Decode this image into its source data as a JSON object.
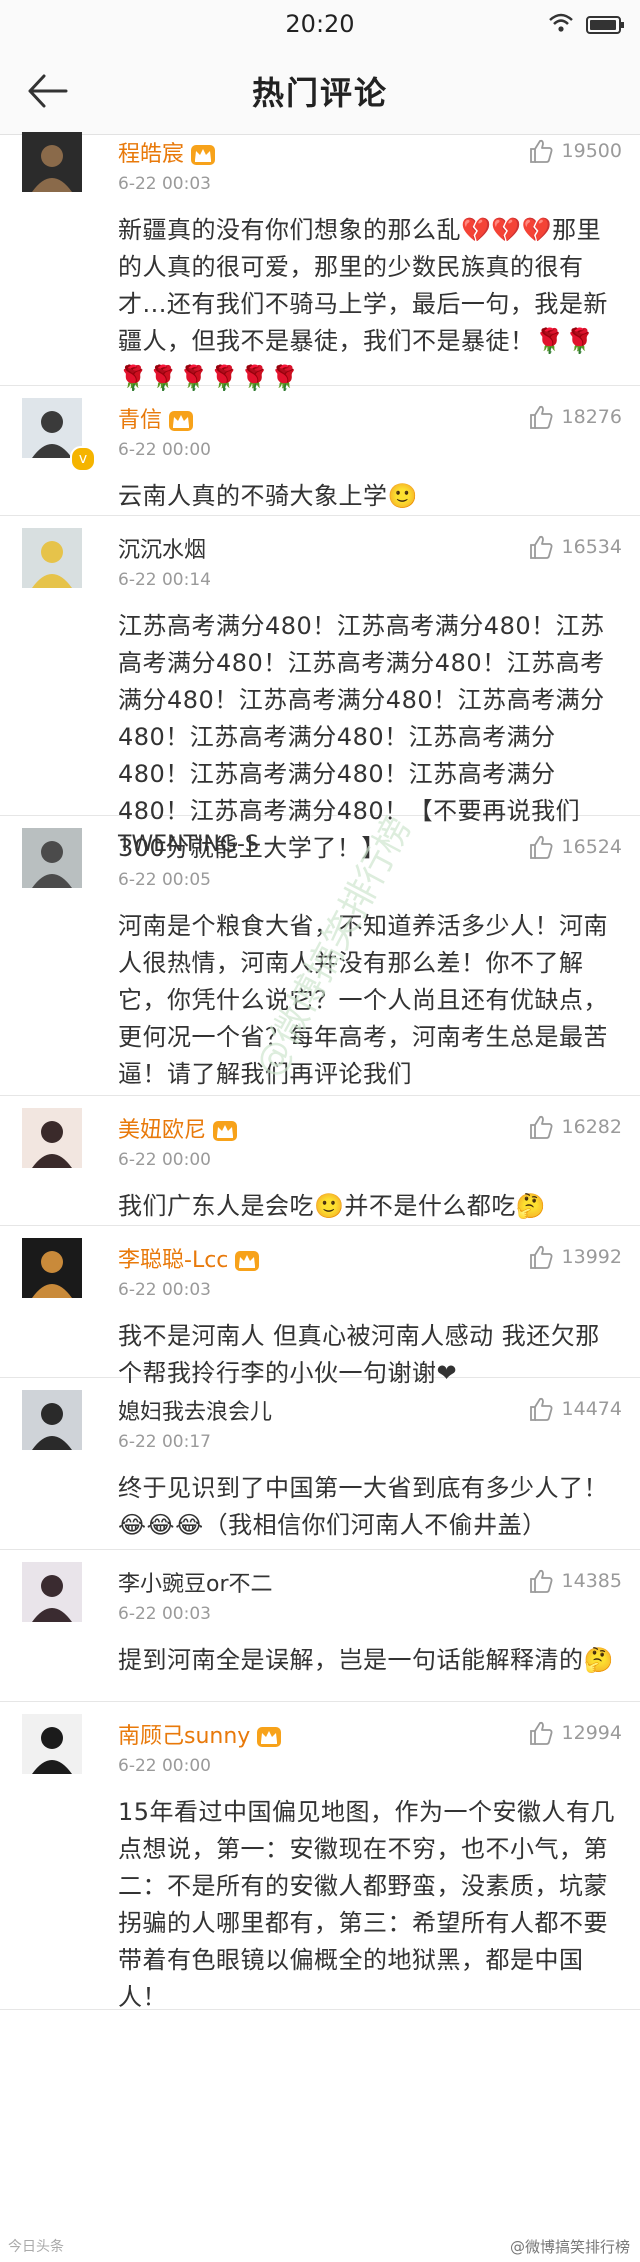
{
  "status": {
    "time": "20:20"
  },
  "header": {
    "title": "热门评论"
  },
  "comments": [
    {
      "name": "程皓宸",
      "time": "6-22 00:03",
      "likes": "19500",
      "text": "新疆真的没有你们想象的那么乱💔💔💔那里的人真的很可爱，那里的少数民族真的很有才...还有我们不骑马上学，最后一句，我是新疆人，但我不是暴徒，我们不是暴徒！🌹🌹🌹🌹🌹🌹🌹🌹"
    },
    {
      "name": "青信",
      "time": "6-22 00:00",
      "likes": "18276",
      "text": "云南人真的不骑大象上学🙂"
    },
    {
      "name": "沉沉水烟",
      "time": "6-22 00:14",
      "likes": "16534",
      "text": "江苏高考满分480！江苏高考满分480！江苏高考满分480！江苏高考满分480！江苏高考满分480！江苏高考满分480！江苏高考满分480！江苏高考满分480！江苏高考满分480！江苏高考满分480！江苏高考满分480！江苏高考满分480！【不要再说我们300分就能上大学了！】"
    },
    {
      "name": "TWENTING-S",
      "time": "6-22 00:05",
      "likes": "16524",
      "text": "河南是个粮食大省，不知道养活多少人！河南人很热情，河南人并没有那么差！你不了解它，你凭什么说它？一个人尚且还有优缺点，更何况一个省？每年高考，河南考生总是最苦逼！请了解我们再评论我们"
    },
    {
      "name": "美妞欧尼",
      "time": "6-22 00:00",
      "likes": "16282",
      "text": "我们广东人是会吃🙂并不是什么都吃🤔"
    },
    {
      "name": "李聪聪-Lcc",
      "time": "6-22 00:03",
      "likes": "13992",
      "text": "我不是河南人  但真心被河南人感动 我还欠那个帮我拎行李的小伙一句谢谢❤"
    },
    {
      "name": "媳妇我去浪会儿",
      "time": "6-22 00:17",
      "likes": "14474",
      "text": "终于见识到了中国第一大省到底有多少人了！😂😂😂（我相信你们河南人不偷井盖）"
    },
    {
      "name": "李小豌豆or不二",
      "time": "6-22 00:03",
      "likes": "14385",
      "text": "提到河南全是误解，岂是一句话能解释清的🤔"
    },
    {
      "name": "南顾己sunny",
      "time": "6-22 00:00",
      "likes": "12994",
      "text": "15年看过中国偏见地图，作为一个安徽人有几点想说，第一：安徽现在不穷，也不小气，第二：不是所有的安徽人都野蛮，没素质，坑蒙拐骗的人哪里都有，第三：希望所有人都不要带着有色眼镜以偏概全的地狱黑，都是中国人！"
    }
  ],
  "footer": {
    "left": "今日头条",
    "right": "@微博搞笑排行榜"
  },
  "watermark": "@微博搞笑排行榜",
  "colors": {
    "vip_name": "#e8790a",
    "meta_gray": "#9a9a9a"
  }
}
